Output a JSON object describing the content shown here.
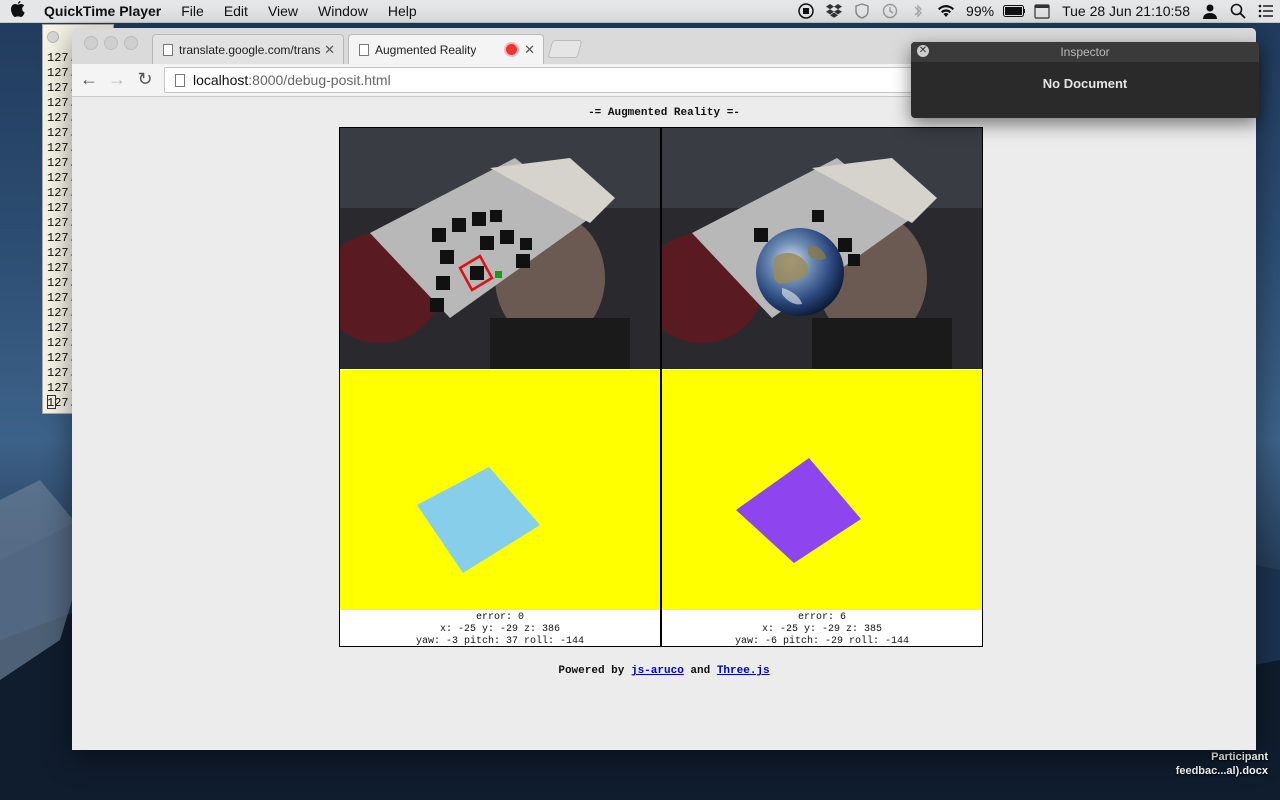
{
  "menubar": {
    "app_name": "QuickTime Player",
    "items": [
      "File",
      "Edit",
      "View",
      "Window",
      "Help"
    ],
    "battery": "99%",
    "datetime": "Tue 28 Jun  21:10:58"
  },
  "terminal": {
    "lines": [
      "127.",
      "127.",
      "127.",
      "127.",
      "127.",
      "127.",
      "127.",
      "127.",
      "127.",
      "127.",
      "127.",
      "127.",
      "127.",
      "127.",
      "127.",
      "127.",
      "127.",
      "127.",
      "127.",
      "127.",
      "127.",
      "127.",
      "127.",
      "127."
    ]
  },
  "browser": {
    "tabs": [
      {
        "title": "translate.google.com/trans",
        "active": false
      },
      {
        "title": "Augmented Reality",
        "active": true
      }
    ],
    "url_host": "localhost",
    "url_path": ":8000/debug-posit.html"
  },
  "page": {
    "title": "-= Augmented Reality =-",
    "left_readout": {
      "error": "error: 0",
      "position": "x: -25 y: -29 z: 386",
      "orientation": "yaw: -3 pitch: 37 roll: -144"
    },
    "right_readout": {
      "error": "error: 6",
      "position": "x: -25 y: -29 z: 385",
      "orientation": "yaw: -6 pitch: -29 roll: -144"
    },
    "powered_prefix": "Powered by",
    "link1": "js-aruco",
    "and": "and",
    "link2": "Three.js",
    "colors": {
      "scene_bg": "#ffff00",
      "left_quad": "#87ceeb",
      "right_quad": "#8e44ee"
    }
  },
  "inspector": {
    "title": "Inspector",
    "body": "No Document"
  },
  "desktop": {
    "file_label_1": "Participant",
    "file_label_2": "feedbac...al).docx"
  }
}
